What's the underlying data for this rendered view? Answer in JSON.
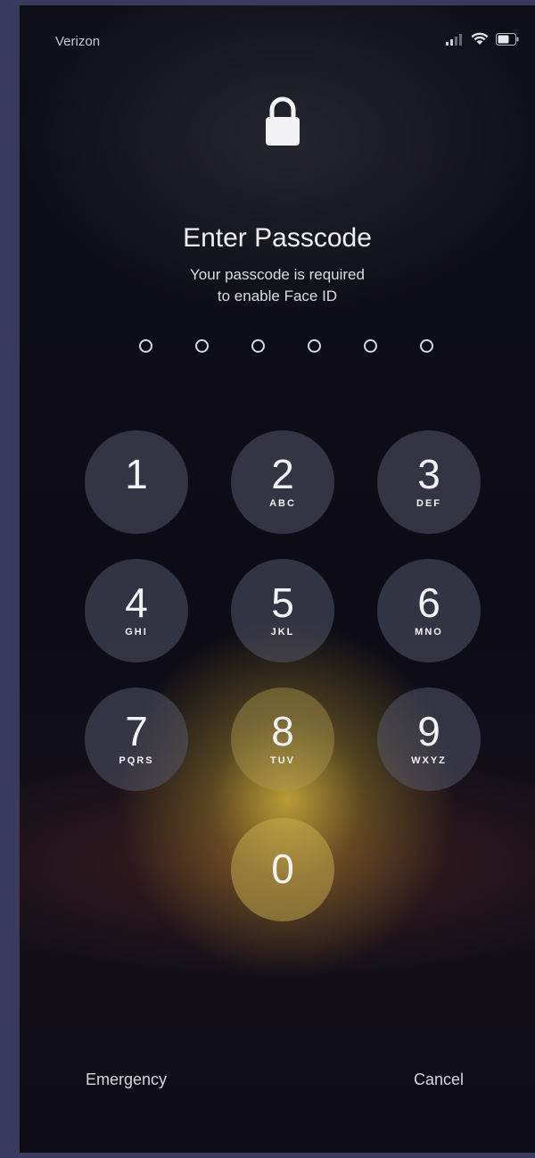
{
  "status_bar": {
    "carrier": "Verizon",
    "icons": [
      "signal-icon",
      "wifi-icon",
      "battery-icon"
    ]
  },
  "lock_icon": "lock-icon",
  "header": {
    "title": "Enter Passcode",
    "subtitle_line1": "Your passcode is required",
    "subtitle_line2": "to enable Face ID"
  },
  "passcode": {
    "length": 6,
    "entered": 0
  },
  "keypad": {
    "keys": [
      {
        "digit": "1",
        "letters": ""
      },
      {
        "digit": "2",
        "letters": "ABC"
      },
      {
        "digit": "3",
        "letters": "DEF"
      },
      {
        "digit": "4",
        "letters": "GHI"
      },
      {
        "digit": "5",
        "letters": "JKL"
      },
      {
        "digit": "6",
        "letters": "MNO"
      },
      {
        "digit": "7",
        "letters": "PQRS"
      },
      {
        "digit": "8",
        "letters": "TUV"
      },
      {
        "digit": "9",
        "letters": "WXYZ"
      },
      {
        "digit": "0",
        "letters": ""
      }
    ]
  },
  "footer": {
    "emergency_label": "Emergency",
    "cancel_label": "Cancel"
  }
}
